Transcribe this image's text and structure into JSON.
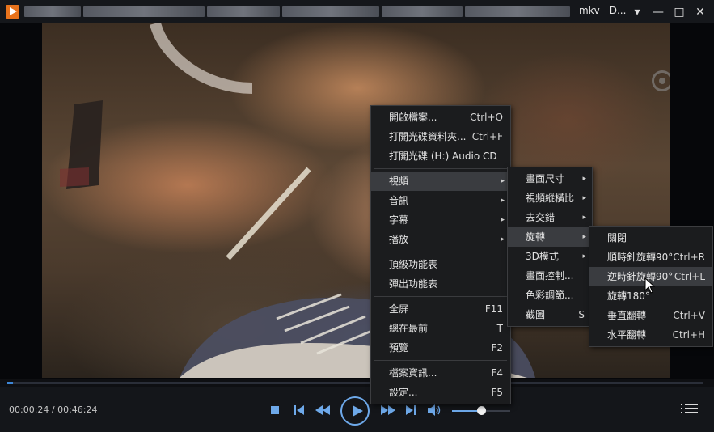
{
  "window": {
    "title_suffix": "mkv - D...",
    "controls": {
      "minimize": "▾",
      "restore": "—",
      "maximize": "□",
      "close": "✕"
    }
  },
  "playback": {
    "time": "00:00:24 / 00:46:24",
    "progress": 0.0086,
    "volume": 0.5
  },
  "menu_main": {
    "items": [
      {
        "label": "開啟檔案...",
        "key": "Ctrl+O"
      },
      {
        "label": "打開光碟資料夾...",
        "key": "Ctrl+F"
      },
      {
        "label": "打開光碟 (H:) Audio CD",
        "key": ""
      },
      {
        "label": "視頻",
        "submenu": true
      },
      {
        "label": "音訊",
        "submenu": true
      },
      {
        "label": "字幕",
        "submenu": true
      },
      {
        "label": "播放",
        "submenu": true
      },
      {
        "label": "頂級功能表",
        "key": ""
      },
      {
        "label": "彈出功能表",
        "key": ""
      },
      {
        "label": "全屏",
        "key": "F11"
      },
      {
        "label": "總在最前",
        "key": "T"
      },
      {
        "label": "預覽",
        "key": "F2"
      },
      {
        "label": "檔案資訊...",
        "key": "F4"
      },
      {
        "label": "設定...",
        "key": "F5"
      }
    ]
  },
  "menu_video": {
    "items": [
      {
        "label": "畫面尺寸",
        "submenu": true
      },
      {
        "label": "視頻縱橫比",
        "submenu": true
      },
      {
        "label": "去交錯",
        "submenu": true
      },
      {
        "label": "旋轉",
        "submenu": true
      },
      {
        "label": "3D模式",
        "submenu": true
      },
      {
        "label": "畫面控制...",
        "key": ""
      },
      {
        "label": "色彩調節...",
        "key": ""
      },
      {
        "label": "截圖",
        "key": "S"
      }
    ]
  },
  "menu_rotate": {
    "items": [
      {
        "label": "關閉",
        "key": ""
      },
      {
        "label": "順時針旋轉90°",
        "key": "Ctrl+R"
      },
      {
        "label": "逆時針旋轉90°",
        "key": "Ctrl+L"
      },
      {
        "label": "旋轉180°",
        "key": ""
      },
      {
        "label": "垂直翻轉",
        "key": "Ctrl+V"
      },
      {
        "label": "水平翻轉",
        "key": "Ctrl+H"
      }
    ]
  },
  "icons": {
    "app": "app-logo-icon",
    "stop": "stop-icon",
    "prev": "previous-icon",
    "rewind": "rewind-icon",
    "play": "play-icon",
    "forward": "fast-forward-icon",
    "next": "next-icon",
    "volume": "volume-icon",
    "playlist": "playlist-icon",
    "submenu_arrow": "▸"
  },
  "colors": {
    "accent": "#6ea9ea",
    "logo": "#e8731c",
    "menu_bg": "#1b1c1e",
    "menu_highlight": "#3a3c40"
  }
}
